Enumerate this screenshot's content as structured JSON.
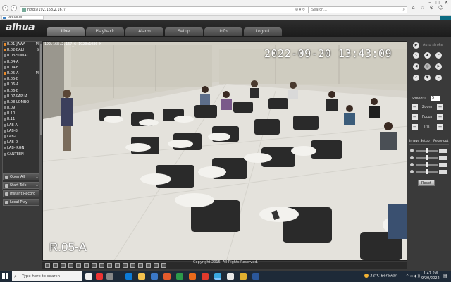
{
  "browser": {
    "url": "http://192.168.2.167/",
    "search_placeholder": "Search...",
    "tab_title": "PREVIEW"
  },
  "app": {
    "logo": "alhua",
    "menu": [
      "Live",
      "Playback",
      "Alarm",
      "Setup",
      "Info",
      "Logout"
    ],
    "active_menu": "Live",
    "channels": [
      {
        "label": "R.01-JAWA",
        "on": true,
        "m": "M"
      },
      {
        "label": "R.02-BALI",
        "on": true,
        "m": "S"
      },
      {
        "label": "R.03-SUMAT",
        "on": false,
        "m": ""
      },
      {
        "label": "R.04-A",
        "on": false,
        "m": ""
      },
      {
        "label": "R.04-B",
        "on": false,
        "m": ""
      },
      {
        "label": "R.05-A",
        "on": true,
        "m": "M"
      },
      {
        "label": "R.05-B",
        "on": false,
        "m": ""
      },
      {
        "label": "R.06-A",
        "on": false,
        "m": ""
      },
      {
        "label": "R.06-B",
        "on": false,
        "m": ""
      },
      {
        "label": "R.07-PAPUA",
        "on": false,
        "m": ""
      },
      {
        "label": "R.08-LOMBO",
        "on": false,
        "m": ""
      },
      {
        "label": "R.09",
        "on": false,
        "m": ""
      },
      {
        "label": "R.10",
        "on": false,
        "m": ""
      },
      {
        "label": "R.11",
        "on": false,
        "m": ""
      },
      {
        "label": "LAB-A",
        "on": false,
        "m": ""
      },
      {
        "label": "LAB-B",
        "on": false,
        "m": ""
      },
      {
        "label": "LAB-C",
        "on": false,
        "m": ""
      },
      {
        "label": "LAB-D",
        "on": false,
        "m": ""
      },
      {
        "label": "LAB-JRGN",
        "on": false,
        "m": ""
      },
      {
        "label": "CANTEEN",
        "on": false,
        "m": ""
      }
    ],
    "left_buttons": [
      "Open All",
      "Start Talk",
      "Instant Record",
      "Local Play"
    ],
    "video": {
      "osd_small": "192.168.2.167_6 1920x1080 H",
      "timestamp": "2022-09-20 13:43:09",
      "camera_name": "R.05-A"
    },
    "ptz": {
      "speed_label": "Speed:1",
      "speed_value": "5",
      "zoom": "Zoom",
      "focus": "Focus",
      "iris": "Iris",
      "image_setup": "Image Setup",
      "relay_out": "Relay-out",
      "reset": "Reset",
      "stroke_label": "Auto stroke"
    },
    "copyright": "Copyright 2015, All Rights Reserved."
  },
  "taskbar": {
    "search_placeholder": "Type here to search",
    "weather": "32°C  Berawan",
    "time": "1:47 PM",
    "date": "9/20/2022"
  }
}
